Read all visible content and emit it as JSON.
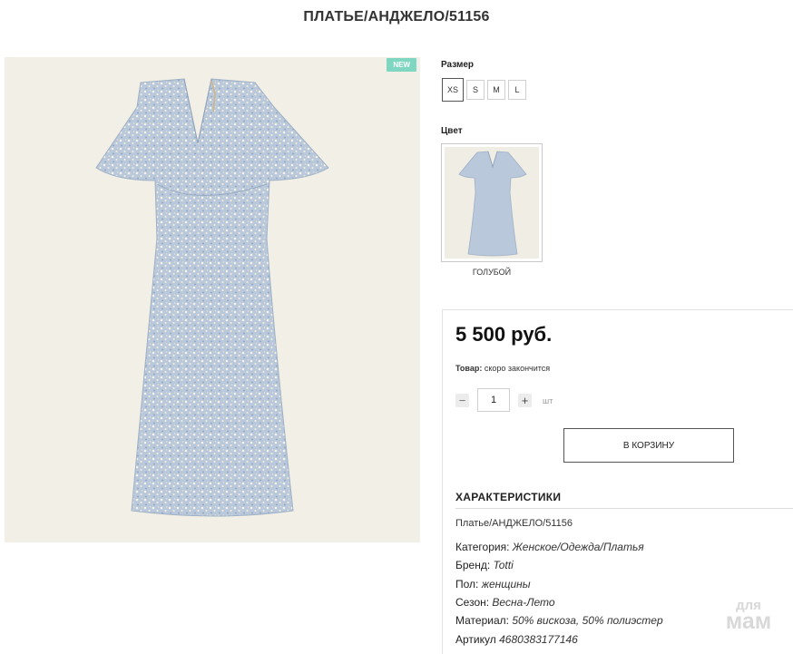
{
  "product": {
    "title": "ПЛАТЬЕ/АНДЖЕЛО/51156",
    "badge": "NEW",
    "image": "blue-floral-dress-photo"
  },
  "size": {
    "label": "Размер",
    "options": [
      "XS",
      "S",
      "M",
      "L"
    ],
    "selected": "XS"
  },
  "color": {
    "label": "Цвет",
    "swatch_name": "ГОЛУБОЙ"
  },
  "buy": {
    "price": "5 500 руб.",
    "stock_label": "Товар:",
    "stock_value": "скоро закончится",
    "quantity": "1",
    "quantity_unit": "шт",
    "minus_icon": "minus-icon",
    "plus_icon": "plus-icon",
    "cart_label": "В КОРЗИНУ"
  },
  "specs": {
    "heading": "ХАРАКТЕРИСТИКИ",
    "article_title": "Платье/АНДЖЕЛО/51156",
    "rows": [
      {
        "label": "Категория:",
        "value": "Женское/Одежда/Платья"
      },
      {
        "label": "Бренд:",
        "value": "Totti"
      },
      {
        "label": "Пол:",
        "value": "женщины"
      },
      {
        "label": "Сезон:",
        "value": "Весна-Лето"
      },
      {
        "label": "Материал:",
        "value": "50% вискоза, 50% полиэстер"
      },
      {
        "label": "Артикул",
        "value": "4680383177146"
      }
    ]
  },
  "watermark": {
    "line1": "для",
    "line2": "мам"
  },
  "colors": {
    "badge": "#7fd6c1",
    "gallery_bg": "#f1efe6",
    "dress": "#b8c7d8"
  }
}
